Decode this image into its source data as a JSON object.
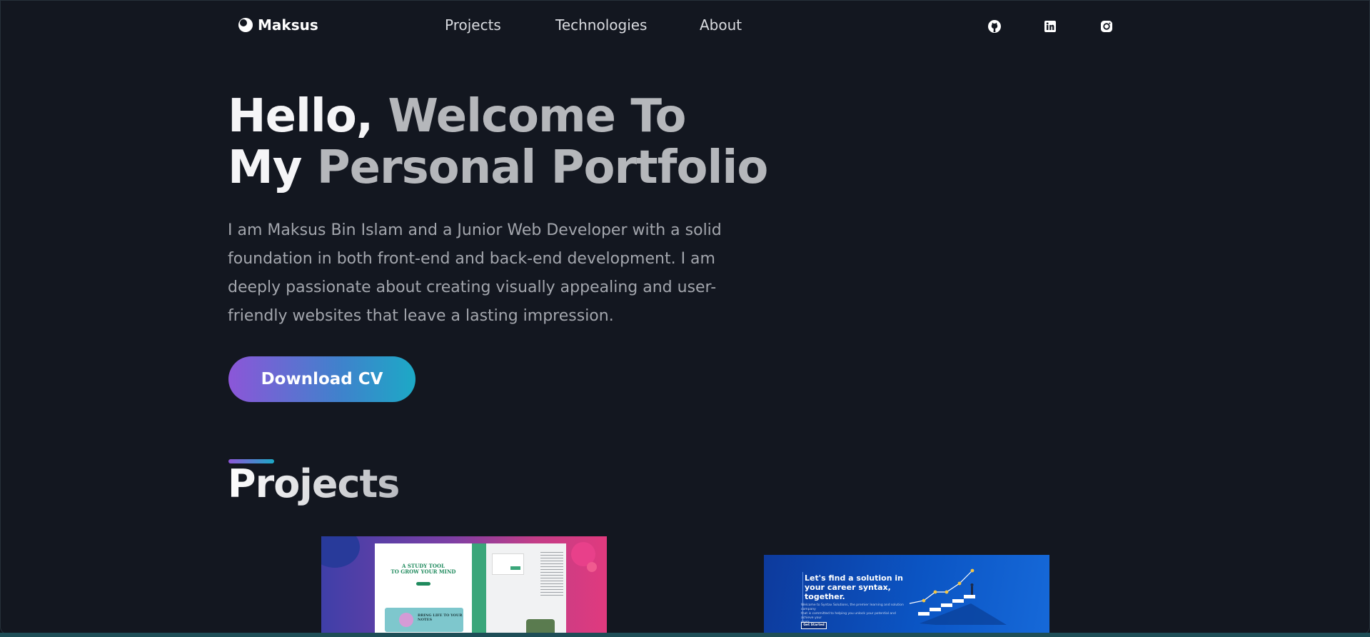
{
  "brand": {
    "name": "Maksus"
  },
  "nav": {
    "links": [
      {
        "label": "Projects"
      },
      {
        "label": "Technologies"
      },
      {
        "label": "About"
      }
    ],
    "social": [
      {
        "icon": "github-icon"
      },
      {
        "icon": "linkedin-icon"
      },
      {
        "icon": "instagram-icon"
      }
    ]
  },
  "hero": {
    "title_line1_white": "Hello, ",
    "title_line1_gray": "Welcome To",
    "title_line2_white": "My ",
    "title_line2_gray": "Personal Portfolio",
    "intro": "I am Maksus Bin Islam and a Junior Web Developer with a solid foundation in both front-end and back-end development. I am deeply passionate about creating visually appealing and user-friendly websites that leave a lasting impression.",
    "cta_label": "Download CV"
  },
  "projects": {
    "heading": "Projects",
    "cards": [
      {
        "headline_line1": "A STUDY TOOL",
        "headline_line2": "TO GROW YOUR MIND",
        "feature_line1": "BRING LIFE TO YOUR",
        "feature_line2": "NOTES"
      },
      {
        "headline_line1": "Let's find a solution in",
        "headline_line2": "your career syntax,",
        "headline_line3": "together.",
        "desc_line1": "Welcome to Syntax Solutions, the premier learning and solution company",
        "desc_line2": "that is committed to helping you unlock your potential and achieve your",
        "desc_line3": "goals.",
        "button_label": "Get Started"
      }
    ]
  },
  "colors": {
    "background": "#131720",
    "accent_start": "#8c56d8",
    "accent_end": "#1ca9c6",
    "heading_white": "#f5f5f7",
    "heading_gray": "#b5b7bb",
    "body_text": "#a3a6ad"
  }
}
